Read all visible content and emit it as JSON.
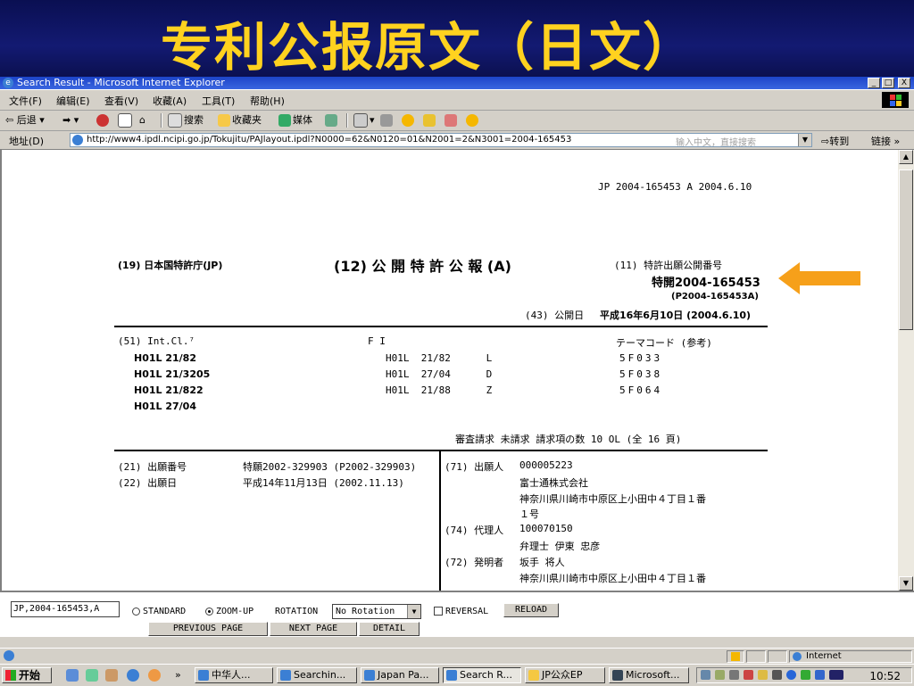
{
  "slide": {
    "title": "专利公报原文（日文）"
  },
  "window": {
    "title": "Search Result - Microsoft Internet Explorer",
    "controls": {
      "minimize": "_",
      "maximize": "□",
      "close": "X"
    }
  },
  "menu": [
    "文件(F)",
    "编辑(E)",
    "查看(V)",
    "收藏(A)",
    "工具(T)",
    "帮助(H)"
  ],
  "toolbar": {
    "back": "后退",
    "search": "搜索",
    "favorites": "收藏夹",
    "media": "媒体"
  },
  "address": {
    "label": "地址(D)",
    "url": "http://www4.ipdl.ncipi.go.jp/Tokujitu/PAJlayout.ipdl?N0000=62&N0120=01&N2001=2&N3001=2004-165453",
    "hint": "输入中文，直接搜索",
    "go": "转到",
    "links": "链接"
  },
  "patent": {
    "header_ref": "JP  2004-165453  A  2004.6.10",
    "office": "(19) 日本国特許庁(JP)",
    "kind": "(12) 公 開 特 許 公 報 (A)",
    "pub_no_label": "(11) 特許出願公開番号",
    "pub_no": "特開2004-165453",
    "pub_no_alt": "(P2004-165453A)",
    "pub_date_label": "(43) 公開日",
    "pub_date": "平成16年6月10日 (2004.6.10)",
    "intcl_label": "(51) Int.Cl.⁷",
    "fi_label": "F I",
    "theme_label": "テーマコード (参考)",
    "intcl": [
      "H01L  21/82",
      "H01L  21/3205",
      "H01L  21/822",
      "H01L  27/04"
    ],
    "fi": [
      "H01L  21/82      L",
      "H01L  27/04      D",
      "H01L  21/88      Z"
    ],
    "theme": [
      "5F033",
      "5F038",
      "5F064"
    ],
    "exam": "審査請求 未請求  請求項の数 10  OL  (全 16 頁)",
    "app_no_label": "(21) 出願番号",
    "app_no": "特願2002-329903 (P2002-329903)",
    "app_date_label": "(22) 出願日",
    "app_date": "平成14年11月13日 (2002.11.13)",
    "applicant_label": "(71) 出願人",
    "applicant_code": "000005223",
    "applicant_name": "富士通株式会社",
    "address_line1": "神奈川県川崎市中原区上小田中４丁目１番",
    "address_line2": "１号",
    "agent_label": "(74) 代理人",
    "agent_code": "100070150",
    "agent_name": "弁理士  伊東  忠彦",
    "inventor_label": "(72) 発明者",
    "inventor_name": "坂手  将人",
    "inventor_addr": "神奈川県川崎市中原区上小田中４丁目１番"
  },
  "controls": {
    "doc_input": "JP,2004-165453,A",
    "standard": "STANDARD",
    "zoom_up": "ZOOM-UP",
    "selected_mode": "ZOOM-UP",
    "rotation_label": "ROTATION",
    "rotation_value": "No Rotation",
    "reversal": "REVERSAL",
    "reload": "RELOAD",
    "prev": "PREVIOUS PAGE",
    "next": "NEXT PAGE",
    "detail": "DETAIL"
  },
  "status": {
    "zone": "Internet"
  },
  "taskbar": {
    "start": "开始",
    "tasks": [
      "中华人...",
      "Searchin...",
      "Japan Pa...",
      "Search R...",
      "JP公众EP",
      "Microsoft..."
    ],
    "active_task": "Search R...",
    "clock": "10:52"
  },
  "colors": {
    "banner_bg": "#0b1050",
    "banner_text": "#ffd21f",
    "arrow": "#f6a01a",
    "title_bar": "#2550d0"
  }
}
